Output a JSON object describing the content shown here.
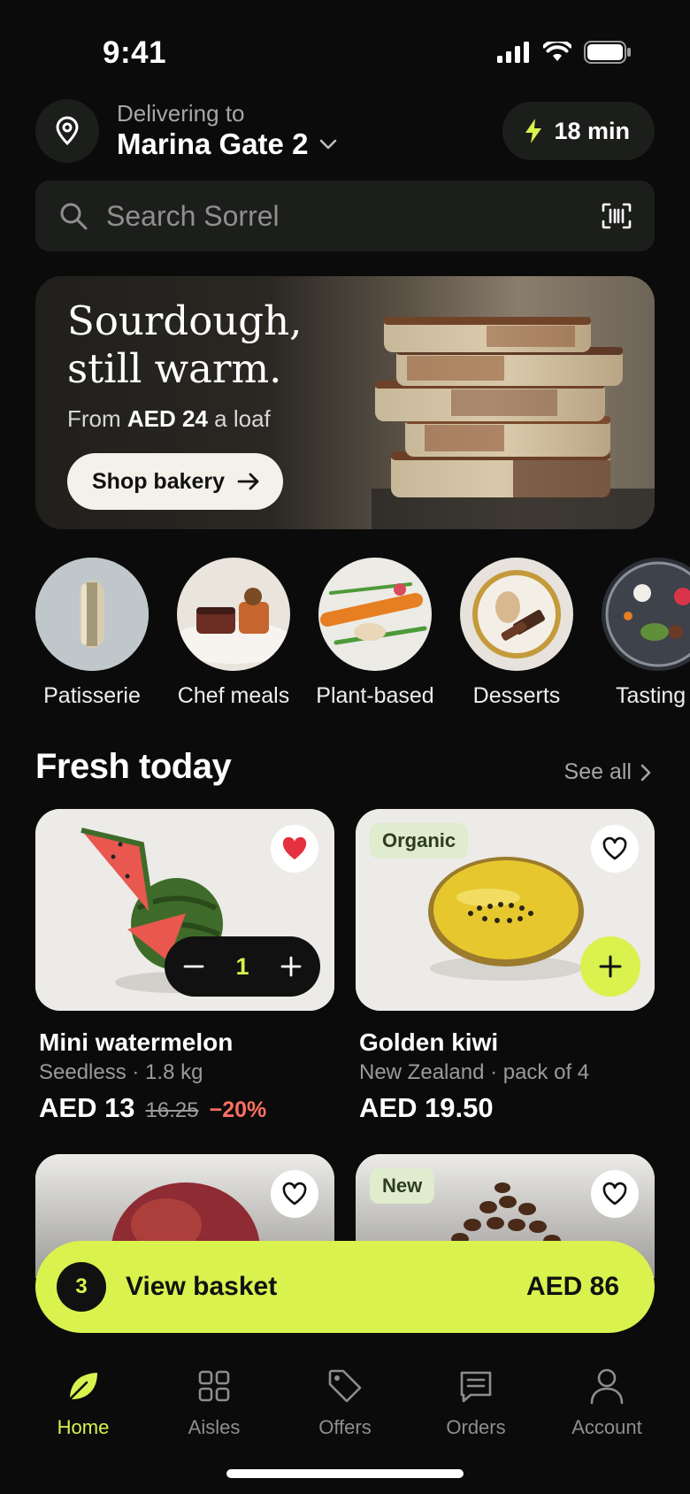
{
  "status_bar": {
    "time": "9:41"
  },
  "header": {
    "deliver_label": "Delivering to",
    "location": "Marina Gate 2",
    "eta": "18 min"
  },
  "search": {
    "placeholder": "Search Sorrel"
  },
  "hero": {
    "title_line1": "Sourdough,",
    "title_line2": "still warm.",
    "sub_prefix": "From ",
    "sub_price": "AED 24",
    "sub_suffix": " a loaf",
    "cta": "Shop bakery"
  },
  "categories": [
    {
      "label": "Patisserie"
    },
    {
      "label": "Chef meals"
    },
    {
      "label": "Plant-based"
    },
    {
      "label": "Desserts"
    },
    {
      "label": "Tasting"
    }
  ],
  "section": {
    "title": "Fresh today",
    "see_all": "See all"
  },
  "products": [
    {
      "name": "Mini watermelon",
      "meta": "Seedless · 1.8 kg",
      "price": "AED 13",
      "old_price": "16.25",
      "discount": "−20%",
      "quantity": "1",
      "favorited": true
    },
    {
      "badge": "Organic",
      "name": "Golden kiwi",
      "meta": "New Zealand · pack of 4",
      "price": "AED 19.50",
      "favorited": false
    },
    {
      "favorited": false
    },
    {
      "badge": "New",
      "favorited": false
    }
  ],
  "basket": {
    "count": "3",
    "label": "View basket",
    "total": "AED 86"
  },
  "tabs": [
    {
      "label": "Home",
      "icon": "leaf-icon",
      "active": true
    },
    {
      "label": "Aisles",
      "icon": "grid-icon"
    },
    {
      "label": "Offers",
      "icon": "tag-icon"
    },
    {
      "label": "Orders",
      "icon": "receipt-icon"
    },
    {
      "label": "Account",
      "icon": "user-icon"
    }
  ],
  "colors": {
    "accent": "#d9f24e",
    "background": "#0b0b0b",
    "surface": "#1c1e1b",
    "discount": "#ff6f61",
    "favorite": "#e5303f"
  }
}
